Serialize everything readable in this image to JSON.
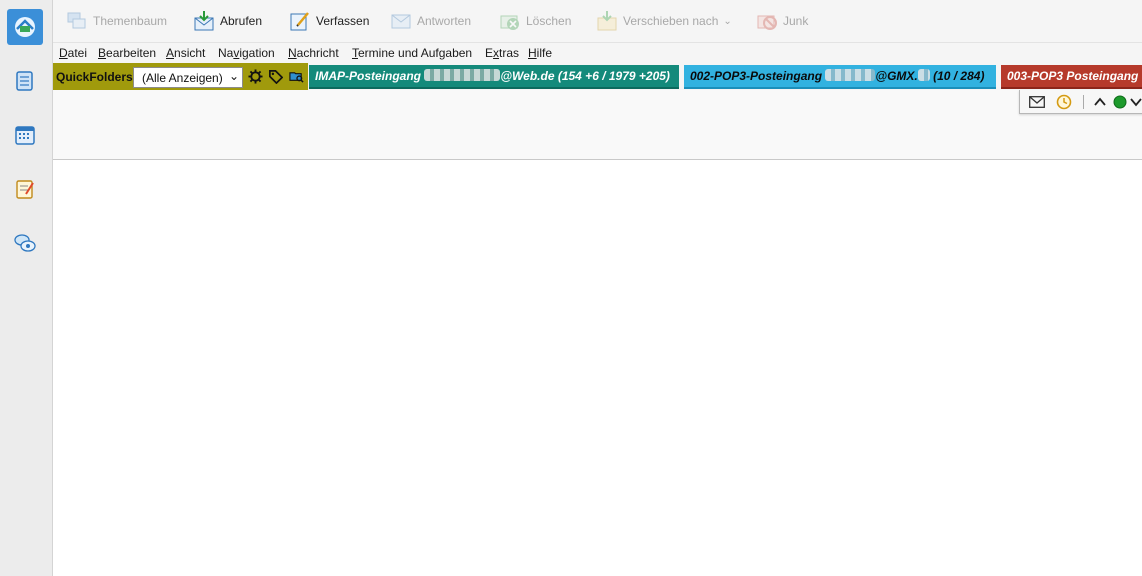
{
  "toolbar": {
    "themenbaum": "Themenbaum",
    "abrufen": "Abrufen",
    "verfassen": "Verfassen",
    "antworten": "Antworten",
    "loeschen": "Löschen",
    "verschieben": "Verschieben nach",
    "junk": "Junk"
  },
  "menu": {
    "datei": {
      "u": "D",
      "rest": "atei"
    },
    "bearbeiten": {
      "u": "B",
      "rest": "earbeiten"
    },
    "ansicht": {
      "u": "A",
      "rest": "nsicht"
    },
    "navigation": {
      "pre": "Na",
      "u": "v",
      "rest": "igation"
    },
    "nachricht": {
      "u": "N",
      "rest": "achricht"
    },
    "termine": {
      "u": "T",
      "rest": "ermine und Aufgaben"
    },
    "extras": {
      "pre": "E",
      "u": "x",
      "rest": "tras"
    },
    "hilfe": {
      "u": "H",
      "rest": "ilfe"
    }
  },
  "quickfolders": {
    "label": "QuickFolders",
    "filter_value": "(Alle Anzeigen)",
    "tabs": [
      {
        "prefix": "IMAP-Posteingang ",
        "suffix": "@Web.de (154 +6 / 1979 +205)",
        "color": "#148a7b"
      },
      {
        "prefix": "002-POP3-Posteingang ",
        "suffix": "@GMX.",
        "counts": " (10 / 284)",
        "color": "#32b2e0"
      },
      {
        "prefix": "003-POP3 Posteingang",
        "suffix": "",
        "color": "#b63a2b"
      }
    ]
  },
  "colors": {
    "accent_space": "#3b8fd8",
    "qf_bar": "#a09a0c",
    "status_green": "#1d9a2c"
  },
  "icons": {
    "spaces": [
      "mail-icon",
      "address-book-icon",
      "calendar-icon",
      "tasks-icon",
      "chat-icon"
    ]
  }
}
